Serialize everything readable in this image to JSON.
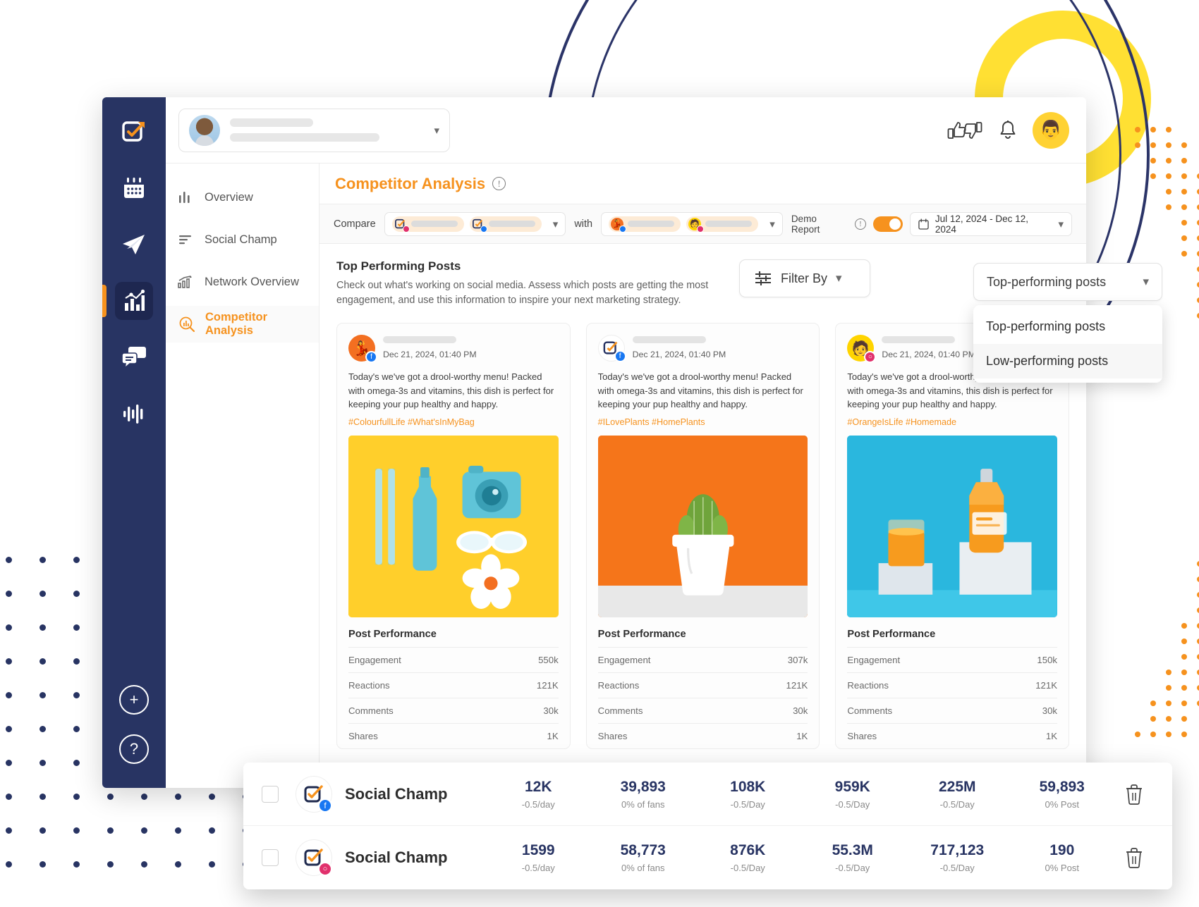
{
  "app": {
    "rail_icons": [
      {
        "name": "compose-check-icon"
      },
      {
        "name": "calendar-icon"
      },
      {
        "name": "paper-plane-icon"
      },
      {
        "name": "analytics-chart-icon"
      },
      {
        "name": "chat-bubbles-icon"
      },
      {
        "name": "audio-waveform-icon"
      }
    ],
    "rail_bottom": [
      {
        "name": "add-button",
        "glyph": "+"
      },
      {
        "name": "help-button",
        "glyph": "?"
      }
    ]
  },
  "topbar": {
    "account_placeholder": "",
    "icons": [
      {
        "name": "thumbs-up-down-icon"
      },
      {
        "name": "notification-bell-icon"
      },
      {
        "name": "user-avatar"
      }
    ]
  },
  "subnav": {
    "items": [
      {
        "label": "Overview",
        "icon": "bar-chart-icon",
        "active": false
      },
      {
        "label": "Social Champ",
        "icon": "list-lines-icon",
        "active": false
      },
      {
        "label": "Network Overview",
        "icon": "growth-chart-icon",
        "active": false
      },
      {
        "label": "Competitor Analysis",
        "icon": "magnifier-chart-icon",
        "active": true
      }
    ]
  },
  "page": {
    "title": "Competitor Analysis",
    "info_glyph": "!"
  },
  "compare_bar": {
    "compare_label": "Compare",
    "with_label": "with",
    "demo_report_label": "Demo Report",
    "demo_report_on": true,
    "date_range": "Jul 12, 2024 - Dec 12, 2024",
    "left_chips": [
      {
        "network": "instagram",
        "accent": "#E1306C"
      },
      {
        "network": "facebook",
        "accent": "#1877F2"
      }
    ],
    "right_chips": [
      {
        "network": "facebook",
        "accent": "#1877F2"
      },
      {
        "network": "instagram",
        "accent": "#E1306C"
      }
    ]
  },
  "section": {
    "title": "Top Performing Posts",
    "description": "Check out what's working on social media. Assess which posts are getting the most engagement, and use this information to inspire your next marketing strategy.",
    "filter_label": "Filter By"
  },
  "sort_dropdown": {
    "selected": "Top-performing posts",
    "options": [
      "Top-performing posts",
      "Low-performing posts"
    ],
    "highlighted": "Low-performing posts",
    "open": true
  },
  "posts": [
    {
      "date": "Dec 21, 2024, 01:40 PM",
      "network": "facebook",
      "network_accent": "#1877F2",
      "avatar_bg": "#F36F21",
      "avatar_glyph": "💃",
      "text": "Today's we've got a drool-worthy menu! Packed with omega-3s and vitamins, this dish is perfect for keeping your pup healthy and happy.",
      "tags": "#ColourfullLife #What'sInMyBag",
      "image_bg": "#FFCF2B",
      "image_subject": "yellow-flatlay-bottle-camera-sunglasses",
      "performance_title": "Post Performance",
      "metrics": [
        {
          "label": "Engagement",
          "value": "550k"
        },
        {
          "label": "Reactions",
          "value": "121K"
        },
        {
          "label": "Comments",
          "value": "30k"
        },
        {
          "label": "Shares",
          "value": "1K"
        }
      ]
    },
    {
      "date": "Dec 21, 2024, 01:40 PM",
      "network": "facebook",
      "network_accent": "#1877F2",
      "avatar_bg": "#FFFFFF",
      "avatar_glyph": "",
      "text": "Today's we've got a drool-worthy menu! Packed with omega-3s and vitamins, this dish is perfect for keeping your pup healthy and happy.",
      "tags": "#ILovePlants #HomePlants",
      "image_bg": "#F5751A",
      "image_subject": "orange-background-cactus-in-white-pot",
      "performance_title": "Post Performance",
      "metrics": [
        {
          "label": "Engagement",
          "value": "307k"
        },
        {
          "label": "Reactions",
          "value": "121K"
        },
        {
          "label": "Comments",
          "value": "30k"
        },
        {
          "label": "Shares",
          "value": "1K"
        }
      ]
    },
    {
      "date": "Dec 21, 2024, 01:40 PM",
      "network": "instagram",
      "network_accent": "#E1306C",
      "avatar_bg": "#FFD400",
      "avatar_glyph": "🧑",
      "text": "Today's we've got a drool-worthy menu! Packed with omega-3s and vitamins, this dish is perfect for keeping your pup healthy and happy.",
      "tags": "#OrangeIsLife #Homemade",
      "image_bg": "#2AB7DE",
      "image_subject": "blue-background-orange-juice-bottle-and-glass",
      "performance_title": "Post Performance",
      "metrics": [
        {
          "label": "Engagement",
          "value": "150k"
        },
        {
          "label": "Reactions",
          "value": "121K"
        },
        {
          "label": "Comments",
          "value": "30k"
        },
        {
          "label": "Shares",
          "value": "1K"
        }
      ]
    }
  ],
  "bottom_table": {
    "rows": [
      {
        "name": "Social Champ",
        "network": "facebook",
        "network_accent": "#1877F2",
        "checked": false,
        "cells": [
          {
            "value": "12K",
            "sub": "-0.5/day"
          },
          {
            "value": "39,893",
            "sub": "0% of fans"
          },
          {
            "value": "108K",
            "sub": "-0.5/Day"
          },
          {
            "value": "959K",
            "sub": "-0.5/Day"
          },
          {
            "value": "225M",
            "sub": "-0.5/Day"
          },
          {
            "value": "59,893",
            "sub": "0% Post"
          }
        ],
        "delete_icon": "trash-icon"
      },
      {
        "name": "Social Champ",
        "network": "instagram",
        "network_accent": "#E1306C",
        "checked": false,
        "cells": [
          {
            "value": "1599",
            "sub": "-0.5/day"
          },
          {
            "value": "58,773",
            "sub": "0% of fans"
          },
          {
            "value": "876K",
            "sub": "-0.5/Day"
          },
          {
            "value": "55.3M",
            "sub": "-0.5/Day"
          },
          {
            "value": "717,123",
            "sub": "-0.5/Day"
          },
          {
            "value": "190",
            "sub": "0% Post"
          }
        ],
        "delete_icon": "trash-icon"
      }
    ]
  },
  "colors": {
    "brand_orange": "#F6921E",
    "navy": "#283463",
    "yellow_deco": "#FFE033",
    "dot_orange": "#F6921E",
    "dot_navy": "#283463"
  }
}
